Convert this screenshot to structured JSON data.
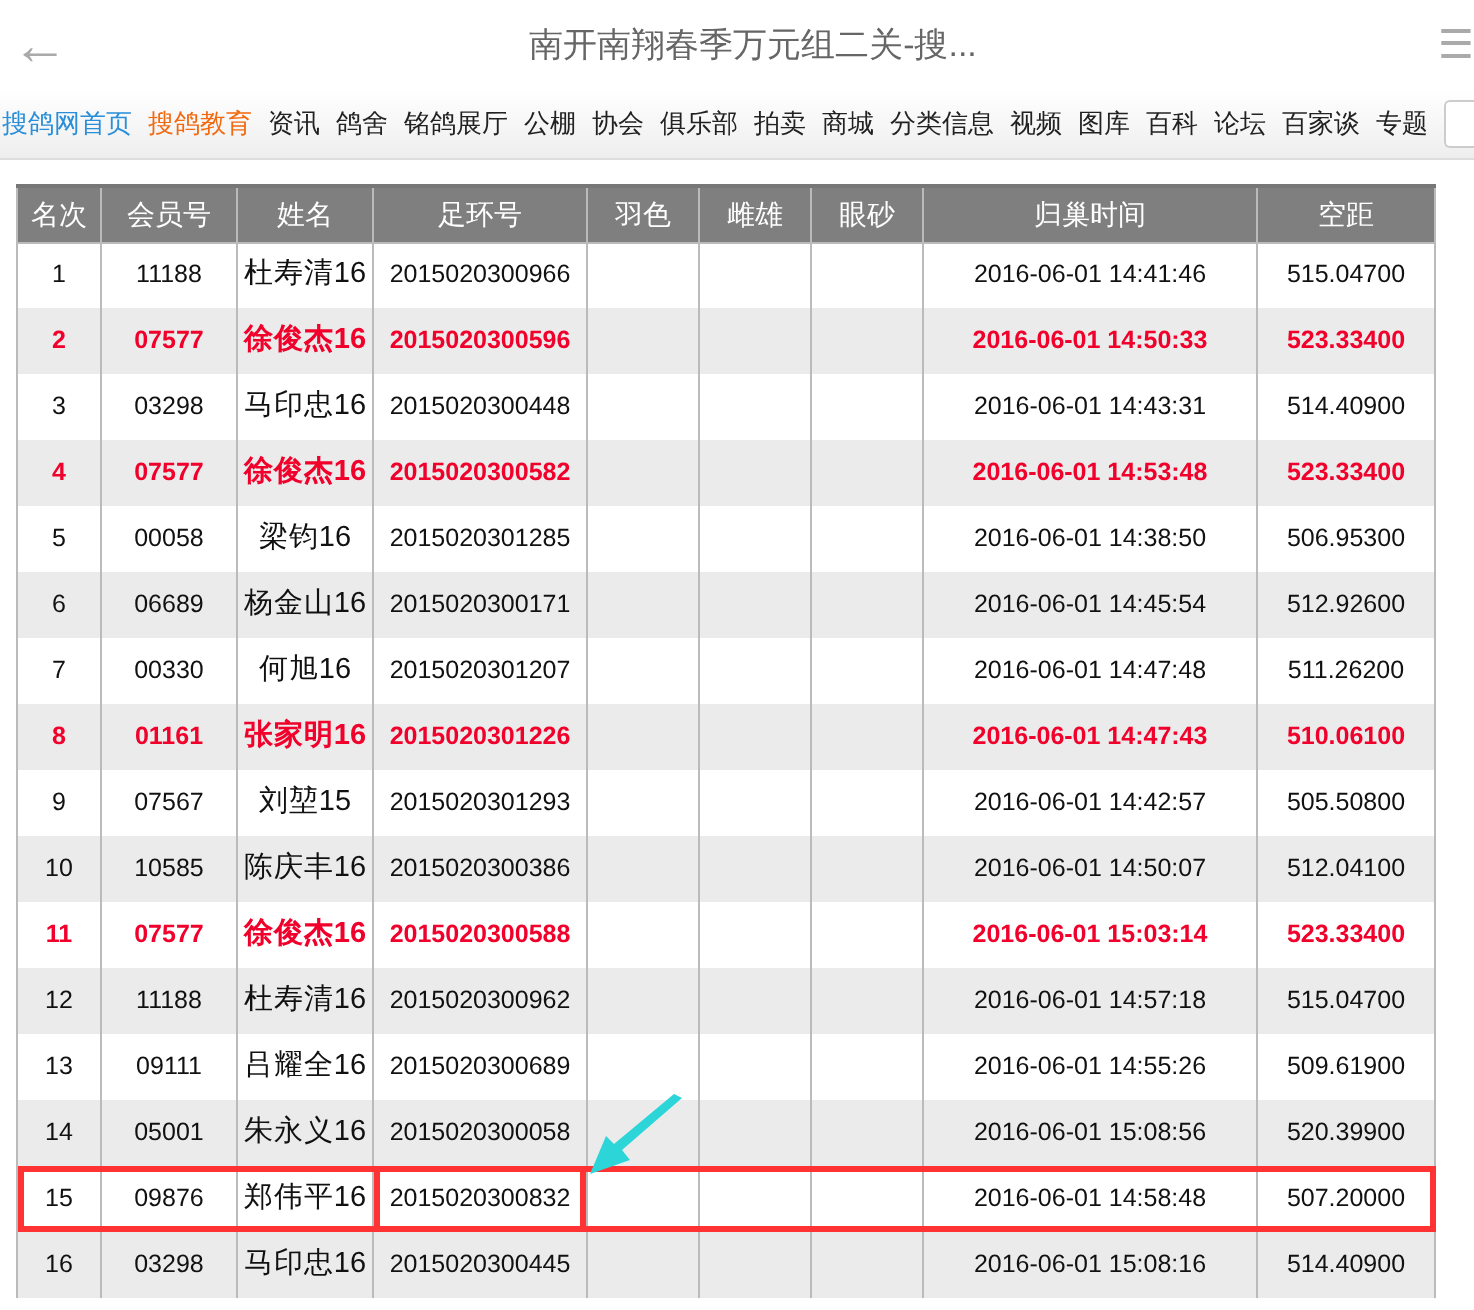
{
  "header": {
    "back": "←",
    "title": "南开南翔春季万元组二关-搜...",
    "menu": "☰"
  },
  "nav": [
    {
      "label": "搜鸽网首页",
      "color": "#2a8fd8"
    },
    {
      "label": "搜鸽教育",
      "color": "#f26a10"
    },
    {
      "label": "资讯",
      "color": "#222222"
    },
    {
      "label": "鸽舍",
      "color": "#222222"
    },
    {
      "label": "铭鸽展厅",
      "color": "#222222"
    },
    {
      "label": "公棚",
      "color": "#222222"
    },
    {
      "label": "协会",
      "color": "#222222"
    },
    {
      "label": "俱乐部",
      "color": "#222222"
    },
    {
      "label": "拍卖",
      "color": "#222222"
    },
    {
      "label": "商城",
      "color": "#222222"
    },
    {
      "label": "分类信息",
      "color": "#222222"
    },
    {
      "label": "视频",
      "color": "#222222"
    },
    {
      "label": "图库",
      "color": "#222222"
    },
    {
      "label": "百科",
      "color": "#222222"
    },
    {
      "label": "论坛",
      "color": "#222222"
    },
    {
      "label": "百家谈",
      "color": "#222222"
    },
    {
      "label": "专题",
      "color": "#222222"
    }
  ],
  "table": {
    "columns": [
      "名次",
      "会员号",
      "姓名",
      "足环号",
      "羽色",
      "雌雄",
      "眼砂",
      "归巢时间",
      "空距"
    ],
    "rows": [
      {
        "cells": [
          "1",
          "11188",
          "杜寿清16",
          "2015020300966",
          "",
          "",
          "",
          "2016-06-01 14:41:46",
          "515.04700"
        ],
        "highlighted": false,
        "marked": false
      },
      {
        "cells": [
          "2",
          "07577",
          "徐俊杰16",
          "2015020300596",
          "",
          "",
          "",
          "2016-06-01 14:50:33",
          "523.33400"
        ],
        "highlighted": true,
        "marked": false
      },
      {
        "cells": [
          "3",
          "03298",
          "马印忠16",
          "2015020300448",
          "",
          "",
          "",
          "2016-06-01 14:43:31",
          "514.40900"
        ],
        "highlighted": false,
        "marked": false
      },
      {
        "cells": [
          "4",
          "07577",
          "徐俊杰16",
          "2015020300582",
          "",
          "",
          "",
          "2016-06-01 14:53:48",
          "523.33400"
        ],
        "highlighted": true,
        "marked": false
      },
      {
        "cells": [
          "5",
          "00058",
          "梁钧16",
          "2015020301285",
          "",
          "",
          "",
          "2016-06-01 14:38:50",
          "506.95300"
        ],
        "highlighted": false,
        "marked": false
      },
      {
        "cells": [
          "6",
          "06689",
          "杨金山16",
          "2015020300171",
          "",
          "",
          "",
          "2016-06-01 14:45:54",
          "512.92600"
        ],
        "highlighted": false,
        "marked": false
      },
      {
        "cells": [
          "7",
          "00330",
          "何旭16",
          "2015020301207",
          "",
          "",
          "",
          "2016-06-01 14:47:48",
          "511.26200"
        ],
        "highlighted": false,
        "marked": false
      },
      {
        "cells": [
          "8",
          "01161",
          "张家明16",
          "2015020301226",
          "",
          "",
          "",
          "2016-06-01 14:47:43",
          "510.06100"
        ],
        "highlighted": true,
        "marked": false
      },
      {
        "cells": [
          "9",
          "07567",
          "刘堃15",
          "2015020301293",
          "",
          "",
          "",
          "2016-06-01 14:42:57",
          "505.50800"
        ],
        "highlighted": false,
        "marked": false
      },
      {
        "cells": [
          "10",
          "10585",
          "陈庆丰16",
          "2015020300386",
          "",
          "",
          "",
          "2016-06-01 14:50:07",
          "512.04100"
        ],
        "highlighted": false,
        "marked": false
      },
      {
        "cells": [
          "11",
          "07577",
          "徐俊杰16",
          "2015020300588",
          "",
          "",
          "",
          "2016-06-01 15:03:14",
          "523.33400"
        ],
        "highlighted": true,
        "marked": false
      },
      {
        "cells": [
          "12",
          "11188",
          "杜寿清16",
          "2015020300962",
          "",
          "",
          "",
          "2016-06-01 14:57:18",
          "515.04700"
        ],
        "highlighted": false,
        "marked": false
      },
      {
        "cells": [
          "13",
          "09111",
          "吕耀全16",
          "2015020300689",
          "",
          "",
          "",
          "2016-06-01 14:55:26",
          "509.61900"
        ],
        "highlighted": false,
        "marked": false
      },
      {
        "cells": [
          "14",
          "05001",
          "朱永义16",
          "2015020300058",
          "",
          "",
          "",
          "2016-06-01 15:08:56",
          "520.39900"
        ],
        "highlighted": false,
        "marked": false
      },
      {
        "cells": [
          "15",
          "09876",
          "郑伟平16",
          "2015020300832",
          "",
          "",
          "",
          "2016-06-01 14:58:48",
          "507.20000"
        ],
        "highlighted": false,
        "marked": true
      },
      {
        "cells": [
          "16",
          "03298",
          "马印忠16",
          "2015020300445",
          "",
          "",
          "",
          "2016-06-01 15:08:16",
          "514.40900"
        ],
        "highlighted": false,
        "marked": false
      }
    ]
  }
}
